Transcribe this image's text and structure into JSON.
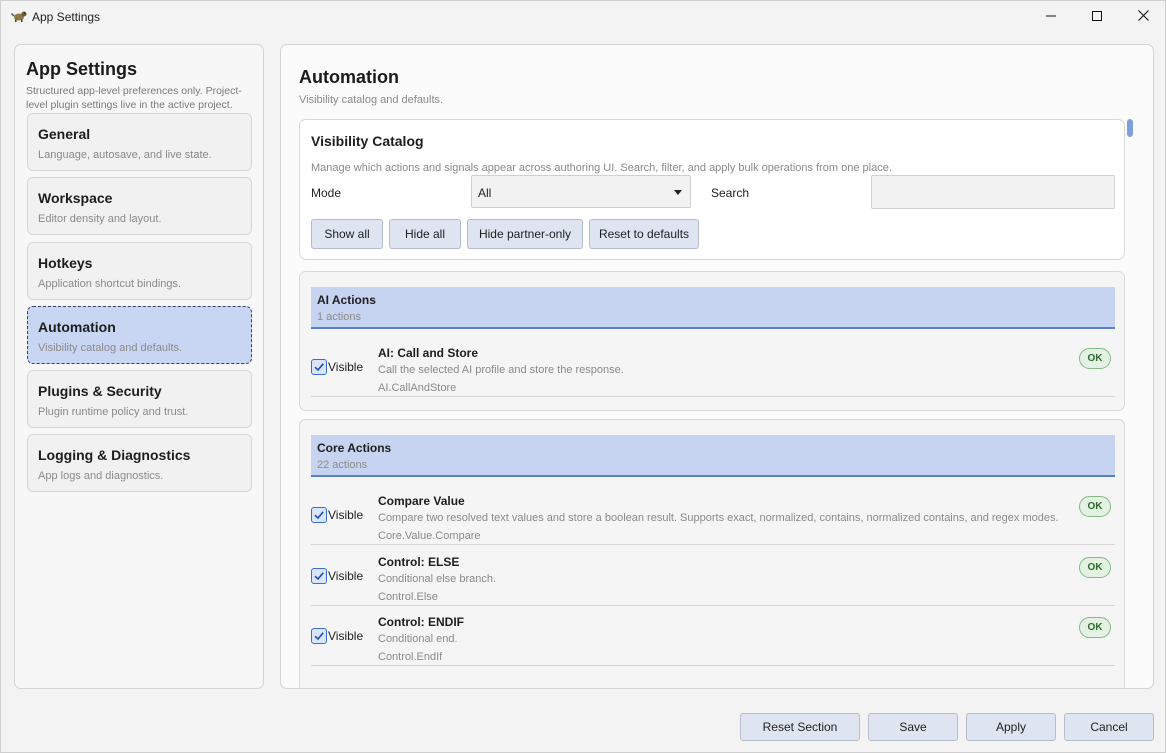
{
  "window": {
    "title": "App Settings",
    "app_icon": "dog-app-icon",
    "controls": [
      "minimize-icon",
      "maximize-icon",
      "close-icon"
    ]
  },
  "sidebar": {
    "title": "App Settings",
    "description": "Structured app-level preferences only. Project-level plugin settings live in the active project.",
    "items": [
      {
        "label": "General",
        "sub": "Language, autosave, and live state."
      },
      {
        "label": "Workspace",
        "sub": "Editor density and layout."
      },
      {
        "label": "Hotkeys",
        "sub": "Application shortcut bindings."
      },
      {
        "label": "Automation",
        "sub": "Visibility catalog and defaults.",
        "active": true
      },
      {
        "label": "Plugins & Security",
        "sub": "Plugin runtime policy and trust."
      },
      {
        "label": "Logging & Diagnostics",
        "sub": "App logs and diagnostics."
      }
    ]
  },
  "main": {
    "title": "Automation",
    "subtitle": "Visibility catalog and defaults.",
    "catalog": {
      "title": "Visibility Catalog",
      "description": "Manage which actions and signals appear across authoring UI. Search, filter, and apply bulk operations from one place.",
      "mode_label": "Mode",
      "mode_value": "All",
      "search_label": "Search",
      "search_placeholder": "",
      "buttons": [
        "Show all",
        "Hide all",
        "Hide partner-only",
        "Reset to defaults"
      ]
    },
    "groups": [
      {
        "title": "AI Actions",
        "count": "1 actions",
        "rows": [
          {
            "visible": true,
            "visible_label": "Visible",
            "title": "AI: Call and Store",
            "desc": "Call the selected AI profile and store the response.",
            "id": "AI.CallAndStore",
            "status": "OK"
          }
        ]
      },
      {
        "title": "Core Actions",
        "count": "22 actions",
        "rows": [
          {
            "visible": true,
            "visible_label": "Visible",
            "title": "Compare Value",
            "desc": "Compare two resolved text values and store a boolean result. Supports exact, normalized, contains, normalized contains, and regex modes.",
            "id": "Core.Value.Compare",
            "status": "OK"
          },
          {
            "visible": true,
            "visible_label": "Visible",
            "title": "Control: ELSE",
            "desc": "Conditional else branch.",
            "id": "Control.Else",
            "status": "OK"
          },
          {
            "visible": true,
            "visible_label": "Visible",
            "title": "Control: ENDIF",
            "desc": "Conditional end.",
            "id": "Control.EndIf",
            "status": "OK"
          }
        ]
      }
    ],
    "scroll_position": 0.0
  },
  "footer": {
    "reset_section": "Reset Section",
    "save": "Save",
    "apply": "Apply",
    "cancel": "Cancel"
  },
  "colors": {
    "accent": "#5a80d0",
    "active_nav": "#c9d6f3",
    "group_header": "#c6d3f1",
    "ok_badge_bg": "#e3f2e3",
    "ok_badge_text": "#2d6a2d",
    "button_bg": "#dfe4f1"
  }
}
